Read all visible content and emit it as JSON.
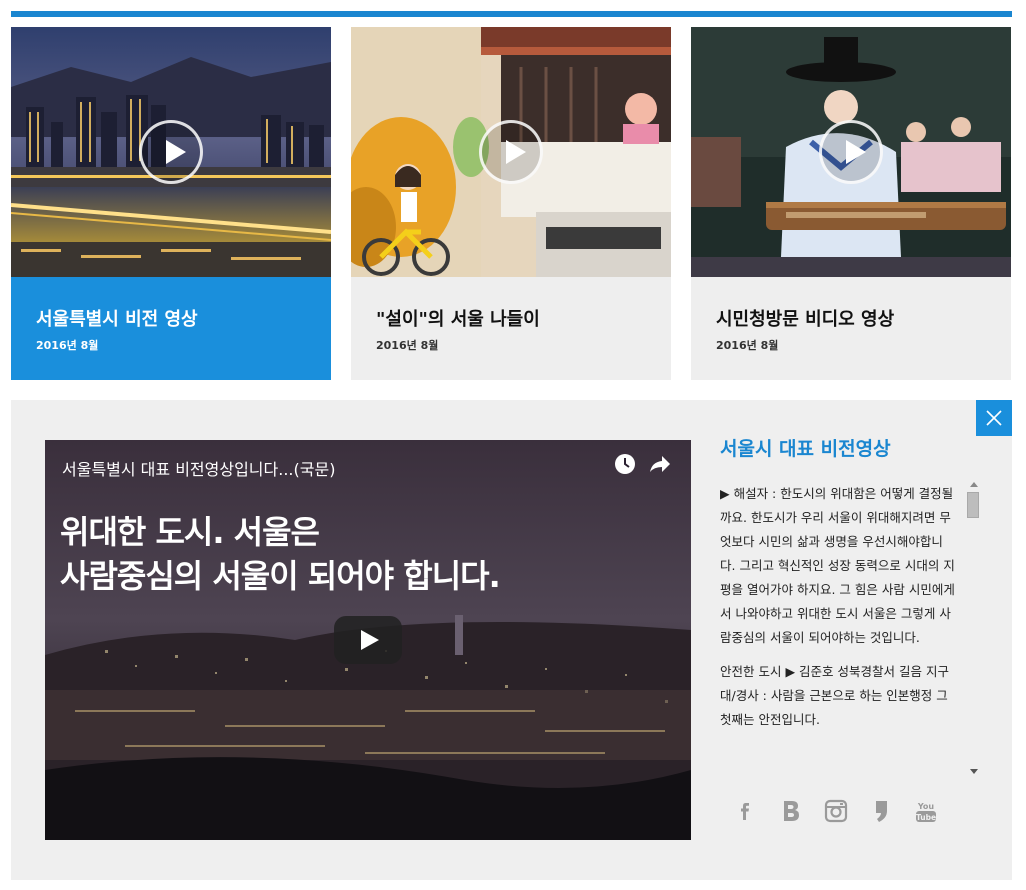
{
  "colors": {
    "accent": "#1a86d0",
    "active_card": "#1a8fdc",
    "card_bg": "#eeeeee",
    "panel_bg": "#efefef"
  },
  "cards": [
    {
      "title": "서울특별시 비전 영상",
      "date": "2016년 8월",
      "active": true,
      "icon": "play-icon"
    },
    {
      "title": "\"설이\"의 서울 나들이",
      "date": "2016년 8월",
      "active": false,
      "icon": "play-icon"
    },
    {
      "title": "시민청방문 비디오 영상",
      "date": "2016년 8월",
      "active": false,
      "icon": "play-icon"
    }
  ],
  "player": {
    "title": "서울특별시 대표 비전영상입니다...(국문)",
    "headline_line1": "위대한 도시. 서울은",
    "headline_line2": "사람중심의 서울이 되어야 합니다.",
    "icons": [
      "clock-icon",
      "share-icon",
      "youtube-play-icon"
    ]
  },
  "side": {
    "title": "서울시 대표 비전영상",
    "paragraph1": "▶ 해설자 : 한도시의 위대함은 어떻게 결정될까요. 한도시가 우리 서울이 위대해지려면 무엇보다 시민의 삶과 생명을 우선시해야합니다. 그리고 혁신적인 성장 동력으로 시대의 지평을 열어가야 하지요. 그 힘은 사람 시민에게서 나와야하고 위대한 도시 서울은 그렇게 사람중심의 서울이 되어야하는 것입니다.",
    "paragraph2": "안전한 도시 ▶ 김준호 성북경찰서 길음 지구대/경사 : 사람을 근본으로 하는 인본행정 그 첫째는 안전입니다."
  },
  "socials": [
    "facebook-icon",
    "blog-icon",
    "instagram-icon",
    "kakaostory-icon",
    "youtube-icon"
  ],
  "close_icon": "close-icon"
}
